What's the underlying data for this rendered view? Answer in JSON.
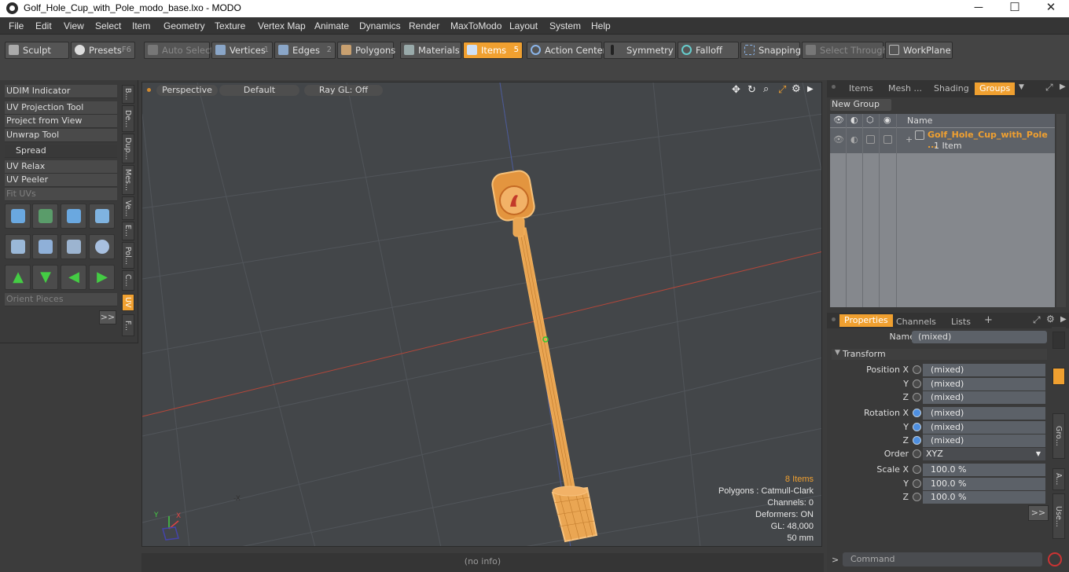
{
  "window": {
    "title": "Golf_Hole_Cup_with_Pole_modo_base.lxo - MODO",
    "minimize": "─",
    "maximize": "☐",
    "close": "✕"
  },
  "menu": [
    "File",
    "Edit",
    "View",
    "Select",
    "Item",
    "Geometry",
    "Texture",
    "Vertex Map",
    "Animate",
    "Dynamics",
    "Render",
    "MaxToModo",
    "Layout",
    "System",
    "Help"
  ],
  "toolbar": {
    "sculpt": "Sculpt",
    "presets": "Presets",
    "presets_key": "F6",
    "auto_select": "Auto Select",
    "vertices": "Vertices",
    "vertices_n": "1",
    "edges": "Edges",
    "edges_n": "2",
    "polygons": "Polygons",
    "materials": "Materials",
    "items": "Items",
    "items_n": "5",
    "action_center": "Action Center",
    "symmetry": "Symmetry",
    "falloff": "Falloff",
    "snapping": "Snapping",
    "select_through": "Select Through",
    "workplane": "WorkPlane"
  },
  "left": {
    "items": [
      "UDIM Indicator",
      "UV Projection Tool",
      "Project from View",
      "Unwrap Tool"
    ],
    "spread": "Spread",
    "items2": [
      "UV Relax",
      "UV Peeler",
      "Fit UVs"
    ],
    "orient": "Orient Pieces",
    "more": ">>",
    "vtabs": [
      "B...",
      "De...",
      "Dup...",
      "Mes...",
      "Ve...",
      "E...",
      "Pol...",
      "C...",
      "UV",
      "F..."
    ]
  },
  "viewport": {
    "perspective": "Perspective",
    "default": "Default",
    "raygl": "Ray GL: Off",
    "items_count": "8 Items",
    "polygons": "Polygons : Catmull-Clark",
    "channels": "Channels: 0",
    "deformers": "Deformers: ON",
    "gl": "GL: 48,000",
    "mm": "50 mm",
    "axis_y": "Y",
    "axis_x": "X",
    "axis_minus_x": "-X"
  },
  "status": "(no info)",
  "right": {
    "tabs": [
      "Items",
      "Mesh ...",
      "Shading",
      "Groups"
    ],
    "new_group": "New Group",
    "col_name": "Name",
    "group_name": "Golf_Hole_Cup_with_Pole ...",
    "group_sub": "1 Item",
    "ptabs": [
      "Properties",
      "Channels",
      "Lists",
      "+"
    ],
    "name_label": "Name",
    "name_value": "(mixed)",
    "transform": "Transform",
    "pos_label": "Position X",
    "rot_label": "Rotation X",
    "y": "Y",
    "z": "Z",
    "mixed": "(mixed)",
    "order_label": "Order",
    "order_value": "XYZ",
    "scale_label": "Scale X",
    "scale_value": "100.0 %",
    "side_tabs": [
      "Gro...",
      "A...",
      "Use..."
    ],
    "more": ">>",
    "command": "Command",
    "prompt": ">"
  },
  "colors": {
    "accent": "#f0a030",
    "viewport_bg": "#434649",
    "selection": "#f0a030"
  }
}
